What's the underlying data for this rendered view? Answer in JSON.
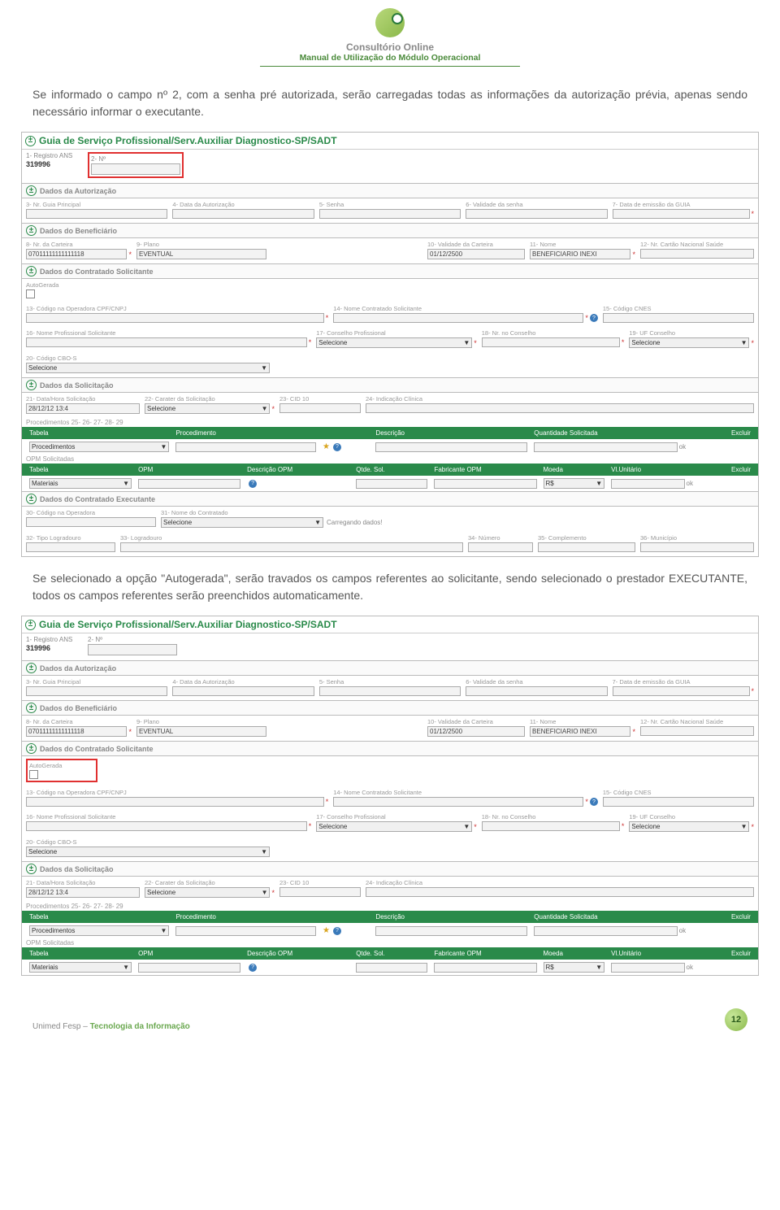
{
  "header": {
    "brand": "Consultório Online",
    "subtitle": "Manual de Utilização do Módulo Operacional"
  },
  "paragraphs": {
    "p1": "Se informado o campo nº 2, com a senha pré autorizada, serão carregadas todas as informações da autorização prévia, apenas sendo necessário informar o executante.",
    "p2": "Se selecionado a opção \"Autogerada\", serão travados os campos referentes ao solicitante, sendo selecionado o prestador EXECUTANTE, todos os campos referentes serão preenchidos automaticamente."
  },
  "form": {
    "title": "Guia de Serviço Profissional/Serv.Auxiliar Diagnostico-SP/SADT",
    "registro": {
      "label": "1- Registro ANS",
      "value": "319996"
    },
    "n2": {
      "label": "2- Nº"
    },
    "sections": {
      "autorizacao": {
        "title": "Dados da Autorização",
        "f3": "3- Nr. Guia Principal",
        "f4": "4- Data da Autorização",
        "f5": "5- Senha",
        "f6": "6- Validade da senha",
        "f7": "7- Data de emissão da GUIA"
      },
      "beneficiario": {
        "title": "Dados do Beneficiário",
        "f8": {
          "label": "8- Nr. da Carteira",
          "value": "07011111111111118"
        },
        "f9": {
          "label": "9- Plano",
          "value": "EVENTUAL"
        },
        "f10": {
          "label": "10- Validade da Carteira",
          "value": "01/12/2500"
        },
        "f11": {
          "label": "11- Nome",
          "value": "BENEFICIARIO INEXI"
        },
        "f12": "12- Nr. Cartão Nacional Saúde"
      },
      "solicitante": {
        "title": "Dados do Contratado Solicitante",
        "autogerada": "AutoGerada",
        "f13": "13- Código na Operadora CPF/CNPJ",
        "f14": "14- Nome Contratado Solicitante",
        "f15": "15- Código CNES",
        "f16": "16- Nome Profissional Solicitante",
        "f17": {
          "label": "17- Conselho Profissional",
          "value": "Selecione"
        },
        "f18": "18- Nr. no Conselho",
        "f19": {
          "label": "19- UF Conselho",
          "value": "Selecione"
        },
        "f20": {
          "label": "20- Código CBO-S",
          "value": "Selecione"
        }
      },
      "solicitacao": {
        "title": "Dados da Solicitação",
        "f21": {
          "label": "21- Data/Hora Solicitação",
          "value": "28/12/12 13:4"
        },
        "f22": {
          "label": "22- Carater da Solicitação",
          "value": "Selecione"
        },
        "f23": "23- CID 10",
        "f24": "24- Indicação Clínica"
      },
      "procedimentos": {
        "rowlabel": "Procedimentos 25- 26- 27- 28- 29",
        "headers": [
          "Tabela",
          "Procedimento",
          "",
          "Descrição",
          "Quantidade Solicitada",
          "Excluir"
        ],
        "tabela": "Procedimentos",
        "ok": "ok"
      },
      "opm": {
        "rowlabel": "OPM Solicitadas",
        "headers": [
          "Tabela",
          "OPM",
          "Descrição OPM",
          "Qtde. Sol.",
          "Fabricante OPM",
          "Moeda",
          "Vl.Unitário",
          "Excluir"
        ],
        "tabela": "Materiais",
        "moeda": "R$",
        "ok": "ok"
      },
      "executante": {
        "title": "Dados do Contratado Executante",
        "f30": "30- Código na Operadora",
        "f31": {
          "label": "31- Nome do Contratado",
          "value": "Selecione",
          "loading": "Carregando dados!"
        },
        "f32": "32- Tipo Logradouro",
        "f33": "33- Logradouro",
        "f34": "34- Número",
        "f35": "35- Complemento",
        "f36": "36- Município"
      }
    }
  },
  "footer": {
    "left_prefix": "Unimed Fesp – ",
    "left_highlight": "Tecnologia da Informação",
    "page": "12"
  }
}
